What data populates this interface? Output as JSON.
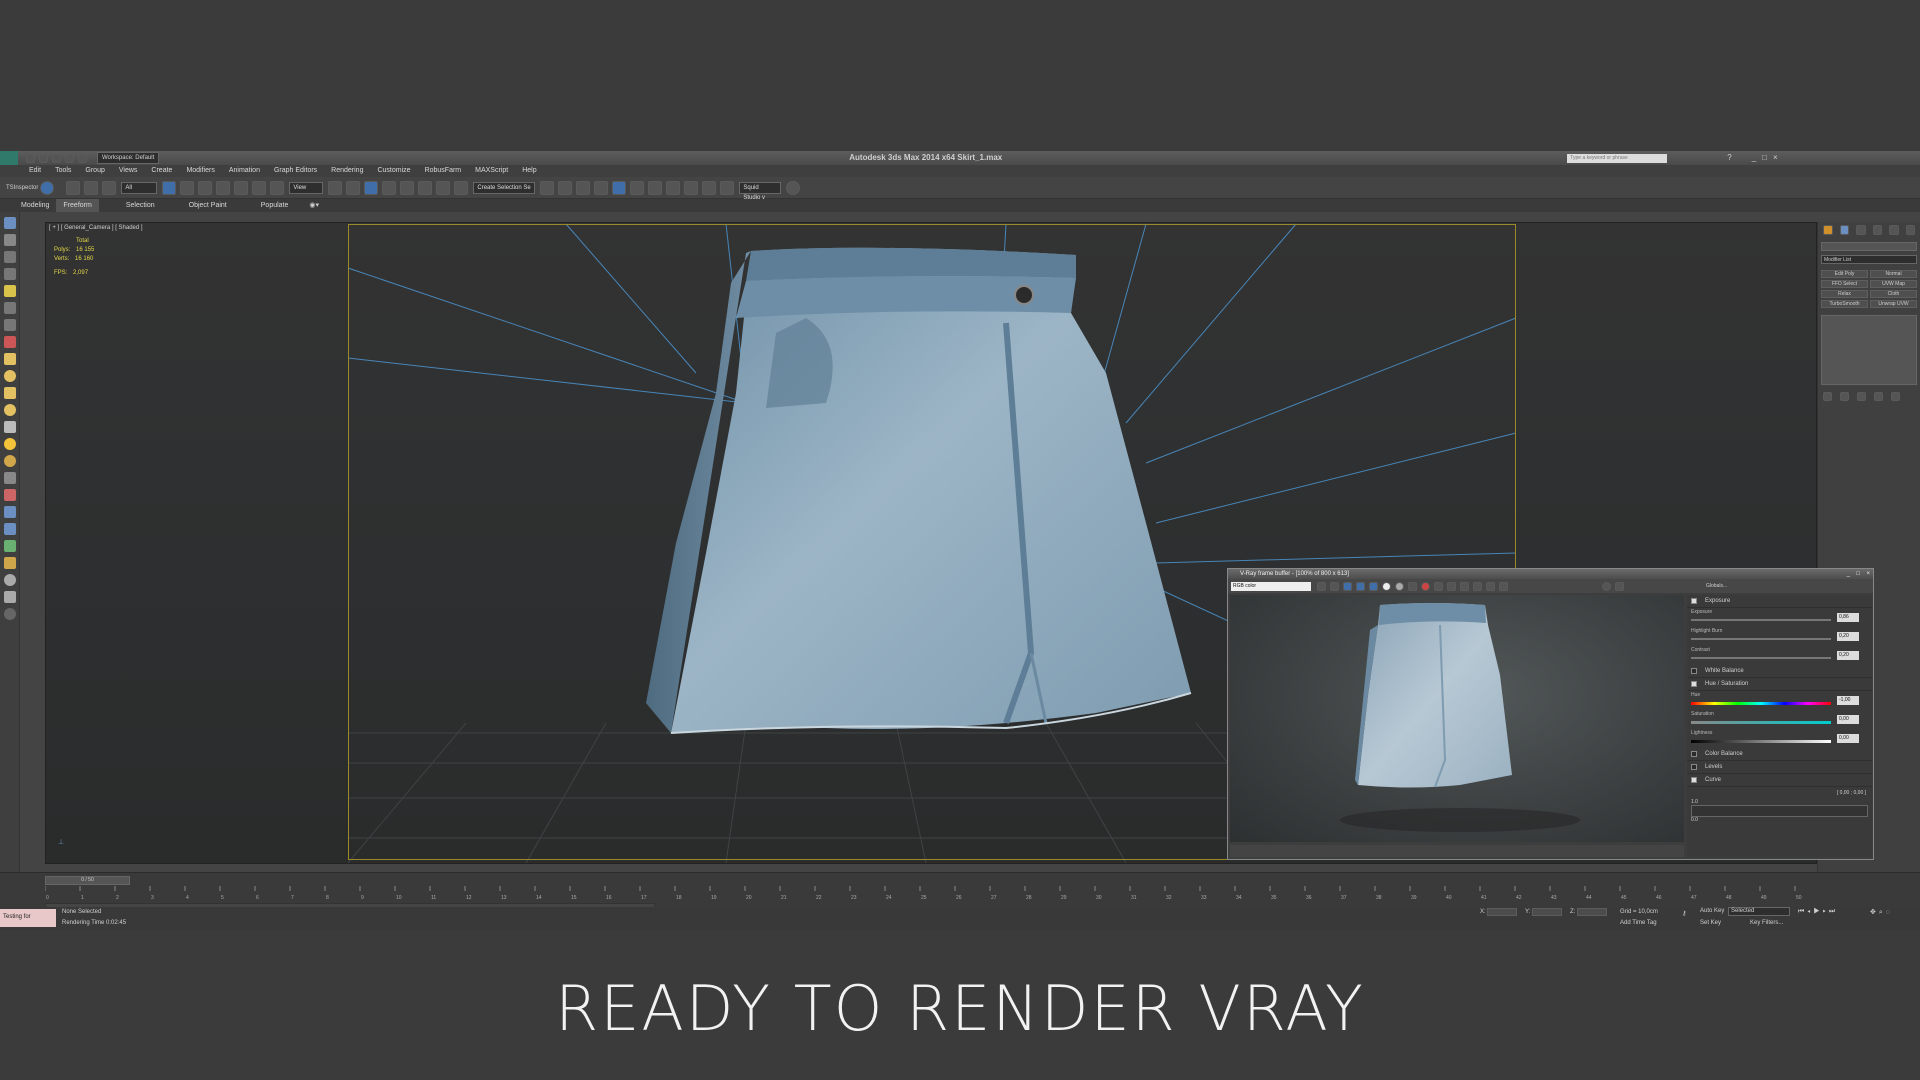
{
  "app": {
    "quick_workspace": "Workspace: Default",
    "title": "Autodesk 3ds Max  2014 x64    Skirt_1.max",
    "search_placeholder": "Type a keyword or phrase"
  },
  "menu": [
    "Edit",
    "Tools",
    "Group",
    "Views",
    "Create",
    "Modifiers",
    "Animation",
    "Graph Editors",
    "Rendering",
    "Customize",
    "RobusFarm",
    "MAXScript",
    "Help"
  ],
  "toolbar": {
    "inspector": "TSInspector",
    "filter": "All",
    "ref_coord": "View",
    "named_selection": "Create Selection Se",
    "squid": "Squid Studio v"
  },
  "ribbon_tabs": [
    "Modeling",
    "Freeform",
    "Selection",
    "Object Paint",
    "Populate"
  ],
  "viewport": {
    "label": "[ + ] [ General_Camera ] [ Shaded ]",
    "stats": {
      "total": "Total",
      "polys_label": "Polys:",
      "polys": "16 155",
      "verts_label": "Verts:",
      "verts": "16 160",
      "fps_label": "FPS:",
      "fps": "2,097"
    }
  },
  "command_panel": {
    "modifier_list": "Modifier List",
    "buttons": [
      "Edit Poly",
      "Normal",
      "FFD Select",
      "UVW Map",
      "Relax",
      "Cloth",
      "TurboSmooth",
      "Unwrap UVW"
    ]
  },
  "timeline": {
    "frame": "0 / 50",
    "ticks": [
      "0",
      "1",
      "2",
      "3",
      "4",
      "5",
      "6",
      "7",
      "8",
      "9",
      "10",
      "11",
      "12",
      "13",
      "14",
      "15",
      "16",
      "17",
      "18",
      "19",
      "20",
      "21",
      "22",
      "23",
      "24",
      "25",
      "26",
      "27",
      "28",
      "29",
      "30",
      "31",
      "32",
      "33",
      "34",
      "35",
      "36",
      "37",
      "38",
      "39",
      "40",
      "41",
      "42",
      "43",
      "44",
      "45",
      "46",
      "47",
      "48",
      "49",
      "50"
    ]
  },
  "status": {
    "testing": "Testing for",
    "selection": "None Selected",
    "render_time": "Rendering Time  0:02:45",
    "x_label": "X:",
    "y_label": "Y:",
    "z_label": "Z:",
    "grid": "Grid = 10,0cm",
    "add_time_tag": "Add Time Tag",
    "auto_key": "Auto Key",
    "selected": "Selected",
    "set_key": "Set Key",
    "key_filters": "Key Filters..."
  },
  "vfb": {
    "title": "V-Ray frame buffer - [100% of 800 x 613]",
    "channel": "RGB color",
    "globals": "Globals...",
    "exposure_section": "Exposure",
    "exposure_label": "Exposure",
    "exposure_value": "0,86",
    "highlight_label": "Highlight Burn",
    "highlight_value": "0,20",
    "contrast_label": "Contrast",
    "contrast_value": "0,20",
    "white_balance": "White Balance",
    "hue_sat": "Hue / Saturation",
    "hue_label": "Hue",
    "hue_value": "-1,00",
    "saturation_label": "Saturation",
    "saturation_value": "0,00",
    "lightness_label": "Lightness",
    "lightness_value": "0,00",
    "color_balance": "Color Balance",
    "levels": "Levels",
    "curve": "Curve",
    "curve_coords": "[ 0,00 ; 0,00 ]",
    "curve_scale_top": "1.0",
    "curve_scale_bottom": "0.0"
  },
  "caption": "READY TO RENDER  VRAY",
  "colors": {
    "accent": "#3f6ea8",
    "safe_frame": "#9a8a2a",
    "stats": "#e6d84a",
    "denim": "#8ea9bd"
  }
}
